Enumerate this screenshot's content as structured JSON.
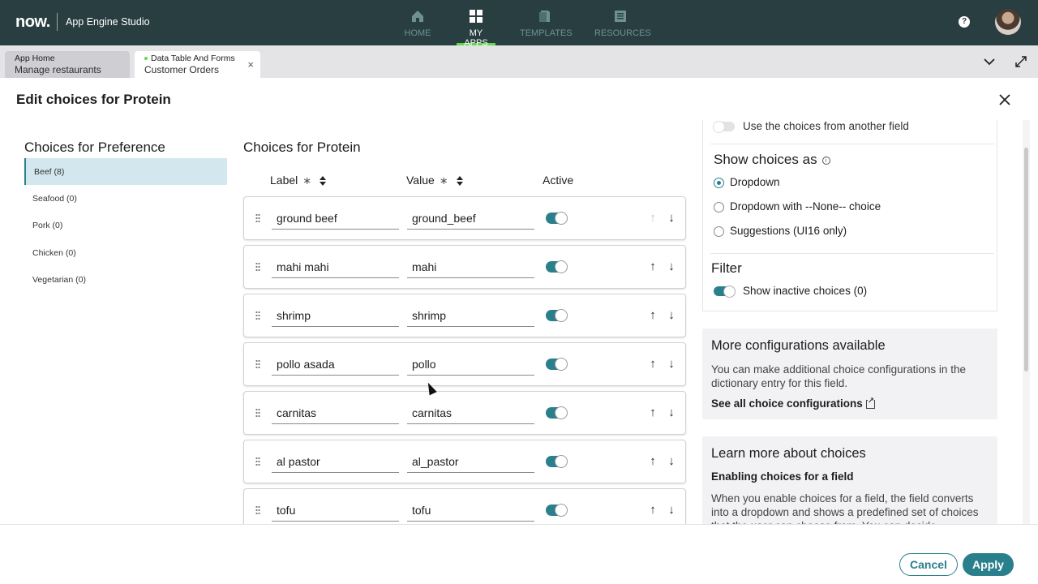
{
  "topbar": {
    "logo": "now.",
    "app_name": "App Engine Studio",
    "nav": [
      {
        "label": "HOME",
        "icon": "home-icon",
        "active": false
      },
      {
        "label": "MY APPS",
        "icon": "grid-icon",
        "active": true
      },
      {
        "label": "TEMPLATES",
        "icon": "template-icon",
        "active": false
      },
      {
        "label": "RESOURCES",
        "icon": "book-icon",
        "active": false
      }
    ],
    "help_icon": "help-icon",
    "help_glyph": "?"
  },
  "tabs": [
    {
      "title": "App Home",
      "subtitle": "Manage restaurants"
    },
    {
      "title": "Data Table And Forms",
      "subtitle": "Customer Orders",
      "close": "×"
    }
  ],
  "modal": {
    "title": "Edit choices for Protein",
    "preferences": {
      "heading": "Choices for Preference",
      "items": [
        "Beef (8)",
        "Seafood (0)",
        "Pork (0)",
        "Chicken (0)",
        "Vegetarian (0)"
      ],
      "selected_index": 0
    },
    "choices": {
      "heading": "Choices for Protein",
      "columns": {
        "label": "Label",
        "value": "Value",
        "active": "Active",
        "required_mark": "∗"
      },
      "rows": [
        {
          "label": "ground beef",
          "value": "ground_beef",
          "active": true,
          "up_enabled": false
        },
        {
          "label": "mahi mahi",
          "value": "mahi",
          "active": true,
          "up_enabled": true
        },
        {
          "label": "shrimp",
          "value": "shrimp",
          "active": true,
          "up_enabled": true
        },
        {
          "label": "pollo asada",
          "value": "pollo",
          "active": true,
          "up_enabled": true
        },
        {
          "label": "carnitas",
          "value": "carnitas",
          "active": true,
          "up_enabled": true
        },
        {
          "label": "al pastor",
          "value": "al_pastor",
          "active": true,
          "up_enabled": true
        },
        {
          "label": "tofu",
          "value": "tofu",
          "active": true,
          "up_enabled": true
        }
      ],
      "up_glyph": "↑",
      "down_glyph": "↓"
    },
    "settings": {
      "use_other_field": "Use the choices from another field",
      "show_as_heading": "Show choices as",
      "info_glyph": "i",
      "options": [
        "Dropdown",
        "Dropdown with --None-- choice",
        "Suggestions (UI16 only)"
      ],
      "selected_option": 0,
      "filter_heading": "Filter",
      "show_inactive": "Show inactive choices (0)"
    },
    "more_config": {
      "title": "More configurations available",
      "text": "You can make additional choice configurations in the dictionary entry for this field.",
      "link": "See all choice configurations"
    },
    "learn_more": {
      "title": "Learn more about choices",
      "subtitle": "Enabling choices for a field",
      "text": "When you enable choices for a field, the field converts into a dropdown and shows a predefined set of choices that the user can choose from. You can decide"
    },
    "footer": {
      "cancel": "Cancel",
      "apply": "Apply"
    }
  },
  "colors": {
    "topbar": "#293e40",
    "accent": "#2a7f8d",
    "nav_active_underline": "#62d84e",
    "selected_bg": "#d3e8ee"
  }
}
